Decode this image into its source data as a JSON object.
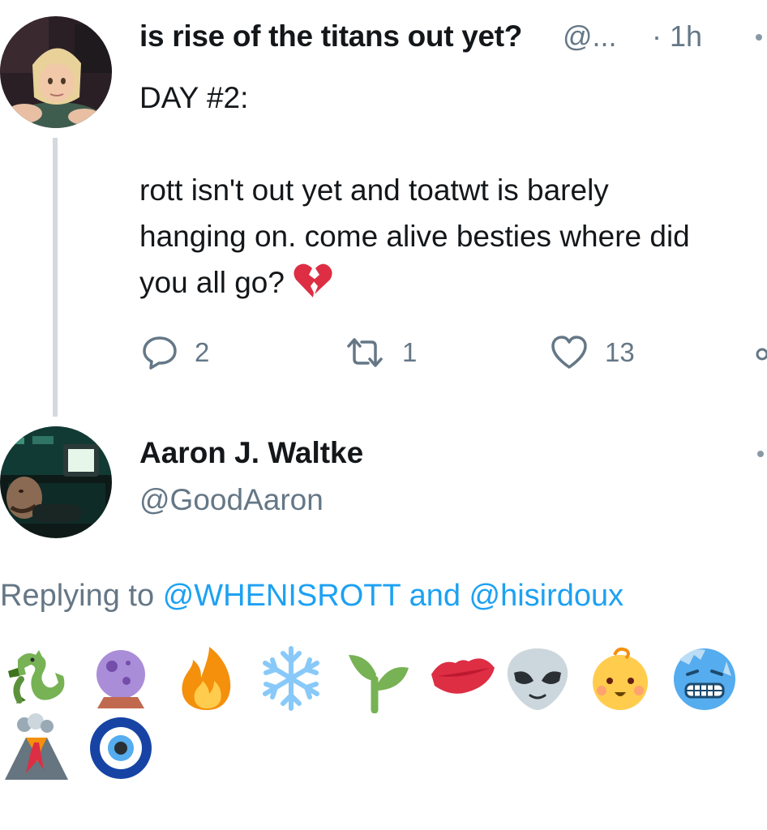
{
  "tweet": {
    "author_name": "is rise of the titans out yet?",
    "author_handle": "@...",
    "time": "· 1h",
    "body_lines": [
      "DAY #2:",
      "rott isn't out yet and toatwt is barely",
      "hanging on. come alive besties where did",
      "you all go?"
    ],
    "body_emoji": "broken-heart",
    "reply_count": "2",
    "retweet_count": "1",
    "like_count": "13"
  },
  "reply": {
    "author_name": "Aaron J. Waltke",
    "author_handle": "@GoodAaron",
    "replying_prefix": "Replying to",
    "mention_1": "@WHENISROTT",
    "and_word": "and",
    "mention_2": "@hisirdoux",
    "emojis": [
      "dragon",
      "crystal-ball",
      "fire",
      "snowflake",
      "seedling",
      "kiss-mark",
      "alien",
      "baby",
      "cold-face",
      "volcano",
      "nazar-amulet"
    ]
  },
  "colors": {
    "text": "#14171a",
    "secondary": "#657786",
    "link": "#1da1f2",
    "thread_line": "#d3d9de"
  }
}
